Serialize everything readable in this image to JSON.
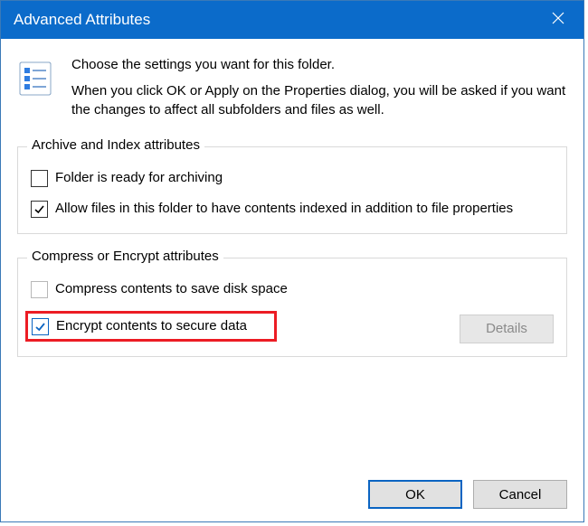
{
  "title": "Advanced Attributes",
  "intro": {
    "line1": "Choose the settings you want for this folder.",
    "line2": "When you click OK or Apply on the Properties dialog, you will be asked if you want the changes to affect all subfolders and files as well."
  },
  "group1": {
    "legend": "Archive and Index attributes",
    "opt_archive": "Folder is ready for archiving",
    "opt_index": "Allow files in this folder to have contents indexed in addition to file properties"
  },
  "group2": {
    "legend": "Compress or Encrypt attributes",
    "opt_compress": "Compress contents to save disk space",
    "opt_encrypt": "Encrypt contents to secure data",
    "details": "Details"
  },
  "buttons": {
    "ok": "OK",
    "cancel": "Cancel"
  }
}
